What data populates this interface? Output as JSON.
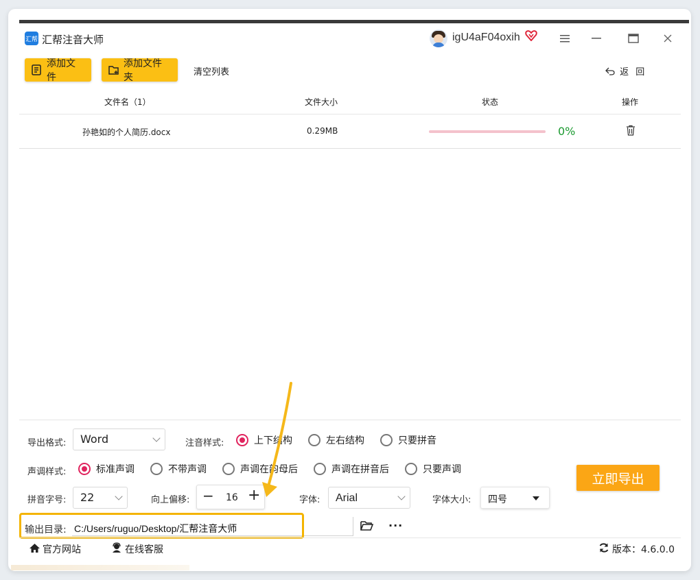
{
  "app": {
    "title": "汇帮注音大师",
    "logo_text": "汇帮",
    "username": "igU4aF04oxih"
  },
  "toolbar": {
    "add_file": "添加文件",
    "add_folder": "添加文件夹",
    "clear_list": "清空列表",
    "back": "返 回"
  },
  "table": {
    "headers": [
      "文件名（1）",
      "文件大小",
      "状态",
      "操作"
    ],
    "rows": [
      {
        "name": "孙艳如的个人简历.docx",
        "size": "0.29MB",
        "progress": 0,
        "progress_text": "0%"
      }
    ]
  },
  "settings": {
    "export_format_label": "导出格式:",
    "export_format_value": "Word",
    "annotation_style_label": "注音样式:",
    "annotation_options": [
      "上下结构",
      "左右结构",
      "只要拼音"
    ],
    "annotation_selected": 0,
    "tone_style_label": "声调样式:",
    "tone_options": [
      "标准声调",
      "不带声调",
      "声调在韵母后",
      "声调在拼音后",
      "只要声调"
    ],
    "tone_selected": 0,
    "pinyin_size_label": "拼音字号:",
    "pinyin_size_value": "22",
    "offset_label": "向上偏移:",
    "offset_value": "16",
    "font_label": "字体:",
    "font_value": "Arial",
    "font_size_label": "字体大小:",
    "font_size_value": "四号",
    "output_dir_label": "输出目录:",
    "output_dir_value": "C:/Users/ruguo/Desktop/汇帮注音大师",
    "export_button": "立即导出"
  },
  "footer": {
    "website": "官方网站",
    "support": "在线客服",
    "version": "版本：4.6.0.0"
  },
  "colors": {
    "accent_yellow": "#fbbf14",
    "export_orange": "#fba615",
    "radio_checked": "#e0245e",
    "progress_green": "#1b9a30",
    "highlight_box": "#f4b400"
  }
}
